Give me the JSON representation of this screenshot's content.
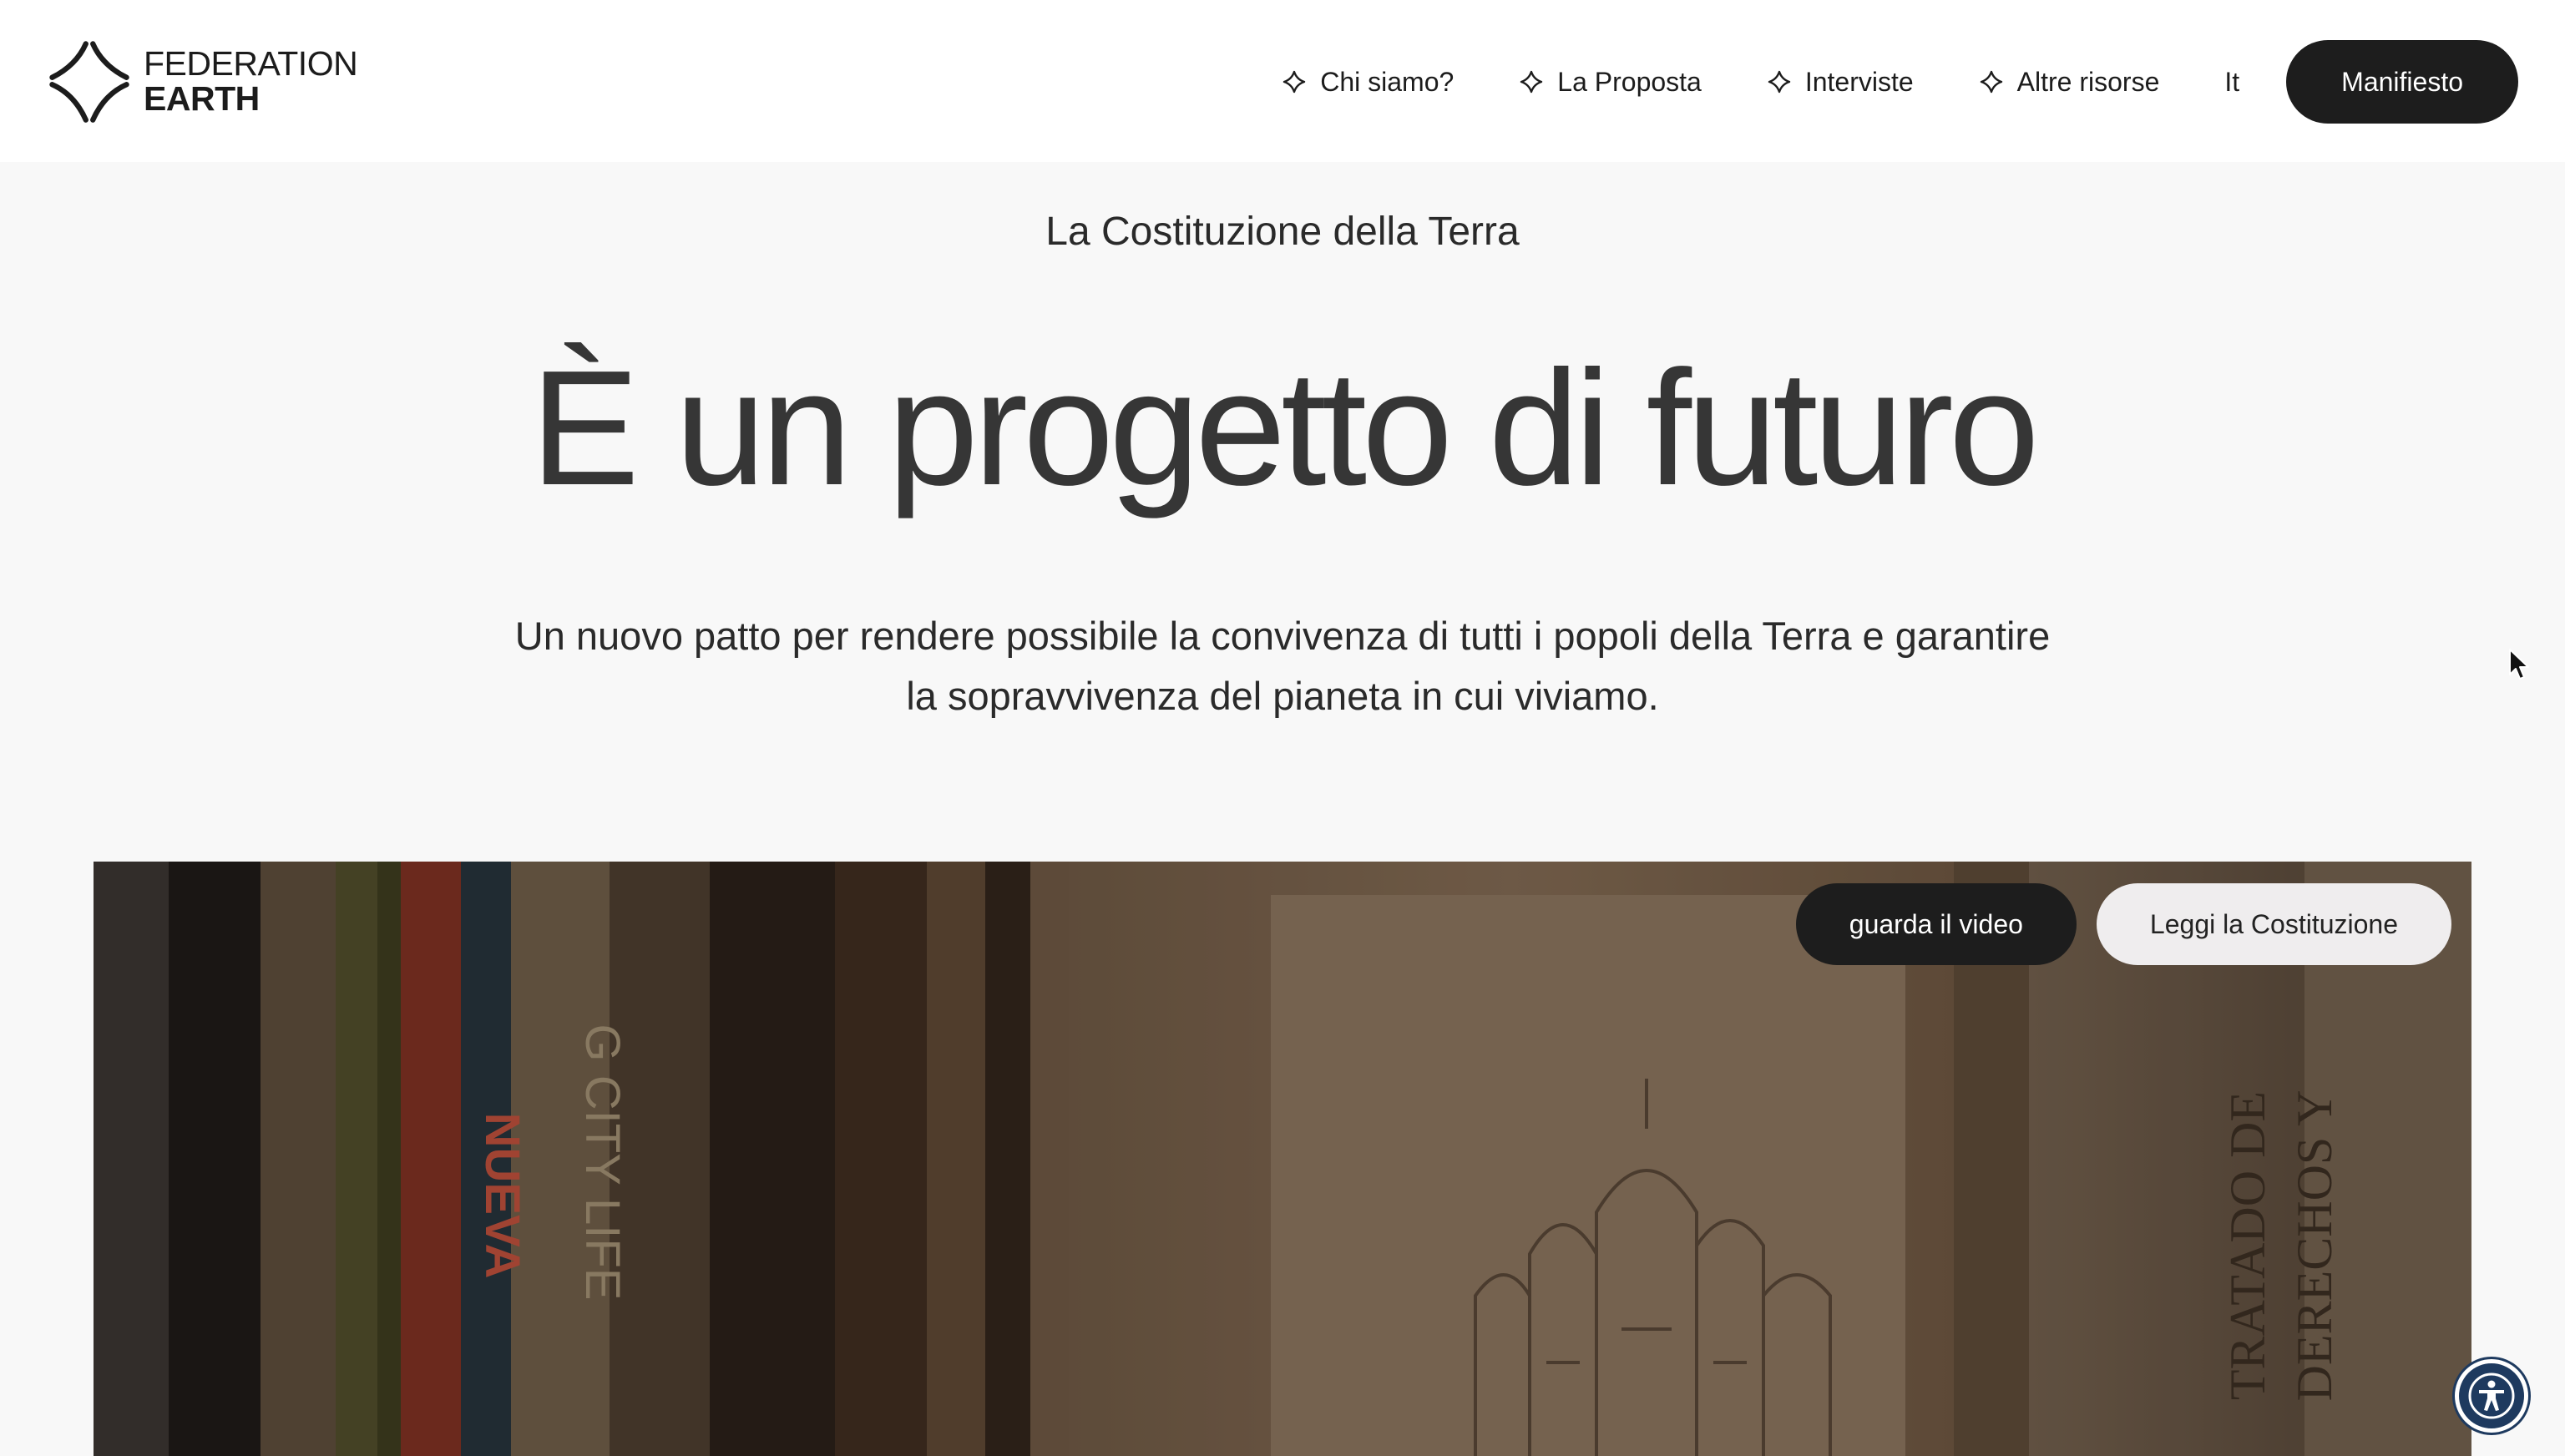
{
  "header": {
    "logo": {
      "line1": "FEDERATION",
      "line2": "EARTH"
    },
    "nav": [
      {
        "label": "Chi siamo?"
      },
      {
        "label": "La Proposta"
      },
      {
        "label": "Interviste"
      },
      {
        "label": "Altre risorse"
      }
    ],
    "language": "It",
    "cta_label": "Manifiesto"
  },
  "hero": {
    "eyebrow": "La Costituzione della Terra",
    "title": "È un progetto di futuro",
    "subtitle": "Un nuovo patto per rendere possibile la convivenza di tutti i popoli della Terra e garantire la sopravvivenza del pianeta in cui viviamo."
  },
  "video": {
    "watch_label": "guarda il video",
    "read_label": "Leggi la Costituzione",
    "book_texts": [
      "NUEVA",
      "G CITY LIFE",
      "TRATADO DE",
      "DERECHOS Y"
    ]
  },
  "colors": {
    "header_bg": "#ffffff",
    "page_bg": "#f8f8f8",
    "dark_button": "#1d1d1d",
    "light_button": "#efedee",
    "accessibility_button": "#1e3a5f"
  }
}
